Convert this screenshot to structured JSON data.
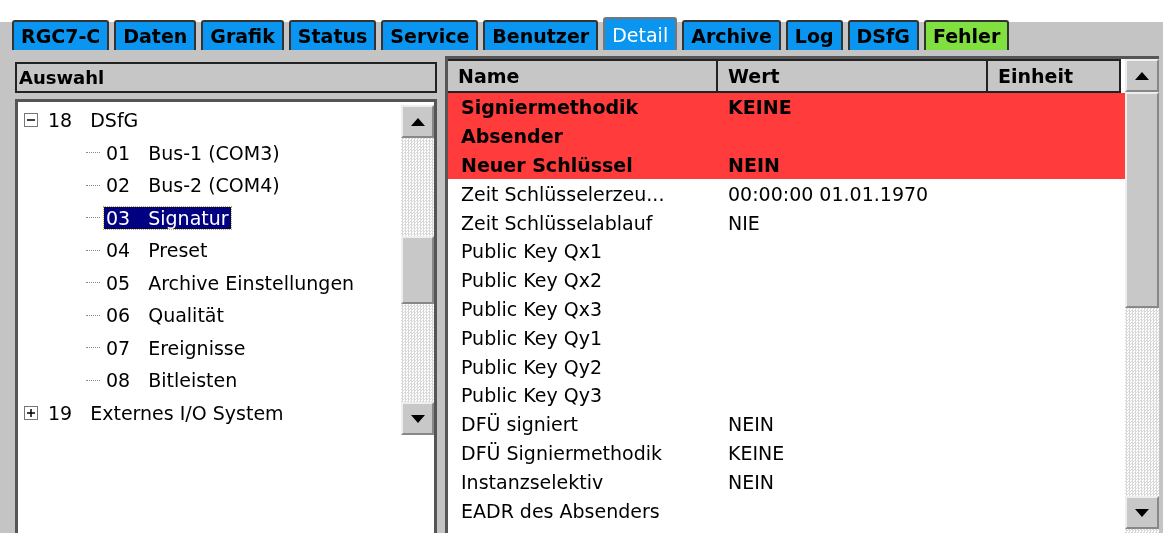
{
  "tabs": [
    {
      "label": "RGC7-C",
      "selected": false,
      "color": "#0a96f0"
    },
    {
      "label": "Daten",
      "selected": false,
      "color": "#0a96f0"
    },
    {
      "label": "Grafik",
      "selected": false,
      "color": "#0a96f0"
    },
    {
      "label": "Status",
      "selected": false,
      "color": "#0a96f0"
    },
    {
      "label": "Service",
      "selected": false,
      "color": "#0a96f0"
    },
    {
      "label": "Benutzer",
      "selected": false,
      "color": "#0a96f0"
    },
    {
      "label": "Detail",
      "selected": true,
      "color": "#0a96f0"
    },
    {
      "label": "Archive",
      "selected": false,
      "color": "#0a96f0"
    },
    {
      "label": "Log",
      "selected": false,
      "color": "#0a96f0"
    },
    {
      "label": "DSfG",
      "selected": false,
      "color": "#0a96f0"
    },
    {
      "label": "Fehler",
      "selected": false,
      "color": "#80e040"
    }
  ],
  "tree": {
    "header": "Auswahl",
    "items": [
      {
        "number": "18",
        "label": "DSfG",
        "expanded": true,
        "selected": false,
        "children": [
          {
            "number": "01",
            "label": "Bus-1 (COM3)",
            "selected": false
          },
          {
            "number": "02",
            "label": "Bus-2 (COM4)",
            "selected": false
          },
          {
            "number": "03",
            "label": "Signatur",
            "selected": true
          },
          {
            "number": "04",
            "label": "Preset",
            "selected": false
          },
          {
            "number": "05",
            "label": "Archive Einstellungen",
            "selected": false
          },
          {
            "number": "06",
            "label": "Qualität",
            "selected": false
          },
          {
            "number": "07",
            "label": "Ereignisse",
            "selected": false
          },
          {
            "number": "08",
            "label": "Bitleisten",
            "selected": false
          }
        ]
      },
      {
        "number": "19",
        "label": "Externes I/O System",
        "expanded": false,
        "selected": false
      }
    ]
  },
  "table": {
    "columns": [
      "Name",
      "Wert",
      "Einheit"
    ],
    "rows": [
      {
        "name": "Signiermethodik",
        "value": "KEINE",
        "error": true
      },
      {
        "name": "Absender",
        "error": true
      },
      {
        "name": "Neuer Schlüssel",
        "value": "NEIN",
        "error": true
      },
      {
        "name": "Zeit Schlüsselerzeu...",
        "value": "00:00:00 01.01.1970",
        "error": false
      },
      {
        "name": "Zeit Schlüsselablauf",
        "value": "NIE",
        "error": false
      },
      {
        "name": "Public Key Qx1",
        "error": false
      },
      {
        "name": "Public Key Qx2",
        "error": false
      },
      {
        "name": "Public Key Qx3",
        "error": false
      },
      {
        "name": "Public Key Qy1",
        "error": false
      },
      {
        "name": "Public Key Qy2",
        "error": false
      },
      {
        "name": "Public Key Qy3",
        "error": false
      },
      {
        "name": "DFÜ signiert",
        "value": "NEIN",
        "error": false
      },
      {
        "name": "DFÜ Signiermethodik",
        "value": "KEINE",
        "error": false
      },
      {
        "name": "Instanzselektiv",
        "value": "NEIN",
        "error": false
      },
      {
        "name": "EADR des Absenders",
        "error": false
      }
    ]
  }
}
